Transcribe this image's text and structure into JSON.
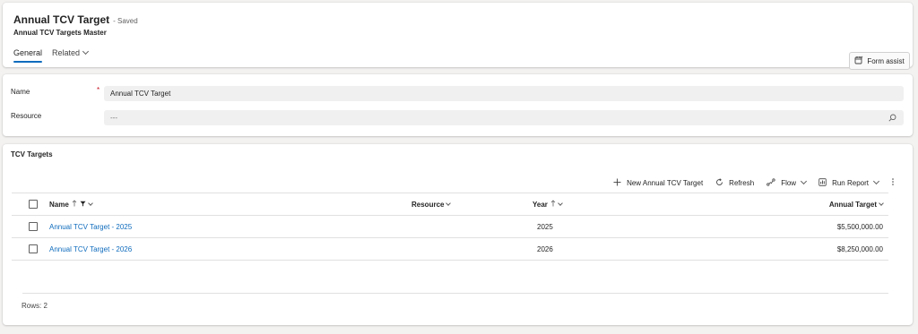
{
  "header": {
    "title": "Annual TCV Target",
    "saved_status": "- Saved",
    "entity_name": "Annual TCV Targets Master",
    "tabs": [
      {
        "label": "General"
      },
      {
        "label": "Related"
      }
    ],
    "form_assist_label": "Form assist"
  },
  "fields": {
    "name": {
      "label": "Name",
      "required_mark": "*",
      "value": "Annual TCV Target"
    },
    "resource": {
      "label": "Resource",
      "value": "---"
    }
  },
  "subgrid": {
    "title": "TCV Targets",
    "commands": {
      "new": "New Annual TCV Target",
      "refresh": "Refresh",
      "flow": "Flow",
      "run_report": "Run Report"
    },
    "columns": {
      "name": "Name",
      "resource": "Resource",
      "year": "Year",
      "annual_target": "Annual Target"
    },
    "rows": [
      {
        "name": "Annual TCV Target - 2025",
        "resource": "",
        "year": "2025",
        "annual_target": "$5,500,000.00"
      },
      {
        "name": "Annual TCV Target - 2026",
        "resource": "",
        "year": "2026",
        "annual_target": "$8,250,000.00"
      }
    ],
    "rows_count": "Rows: 2"
  },
  "colors": {
    "accent": "#0f6cbd",
    "required": "#c50f1f"
  }
}
